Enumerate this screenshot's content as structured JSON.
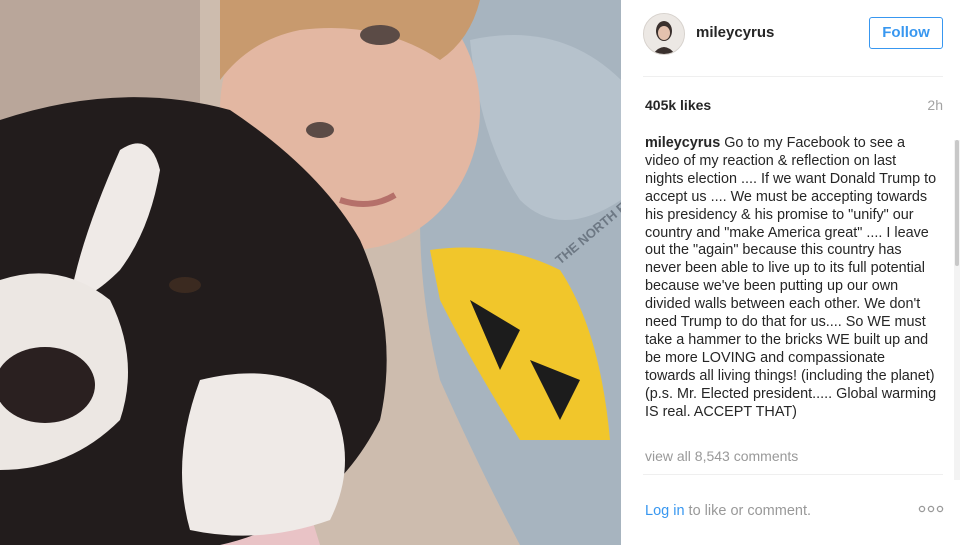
{
  "photo": {
    "alt_icon": "selfie-with-dog-photo",
    "shirt_text": "THE NORTH FACE"
  },
  "header": {
    "username": "mileycyrus",
    "follow_label": "Follow",
    "follow_color": "#3897f0"
  },
  "stats": {
    "likes": "405k likes",
    "time_ago": "2h"
  },
  "caption": {
    "user": "mileycyrus",
    "text": "Go to my Facebook to see a video of my reaction & reflection on last nights election .... If we want Donald Trump to accept us .... We must be accepting towards his presidency & his promise to \"unify\" our country and \"make America great\" .... I leave out the \"again\" because this country has never been able to live up to its full potential because we've been putting up our own divided walls between each other. We don't need Trump to do that for us.... So WE must take a hammer to the bricks WE built up and be more LOVING and compassionate towards all living things! (including the planet) (p.s. Mr. Elected president..... Global warming IS real. ACCEPT THAT)"
  },
  "comments": {
    "view_all": "view all 8,543 comments"
  },
  "footer": {
    "login_link": "Log in",
    "login_rest": " to like or comment.",
    "more_icon": "more-options-icon"
  }
}
